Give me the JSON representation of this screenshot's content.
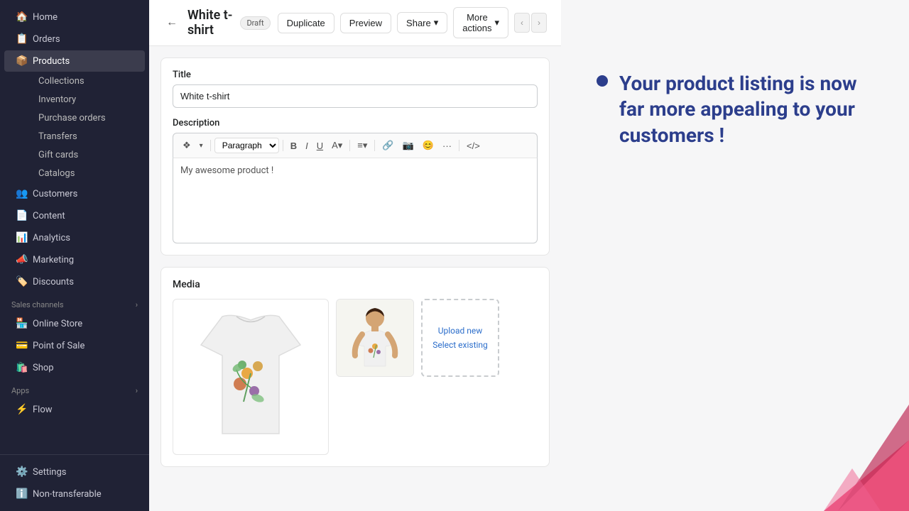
{
  "sidebar": {
    "items": [
      {
        "label": "Home",
        "icon": "🏠",
        "id": "home"
      },
      {
        "label": "Orders",
        "icon": "📋",
        "id": "orders"
      },
      {
        "label": "Products",
        "icon": "📦",
        "id": "products",
        "active": true
      },
      {
        "label": "Customers",
        "icon": "👥",
        "id": "customers"
      },
      {
        "label": "Content",
        "icon": "📄",
        "id": "content"
      },
      {
        "label": "Analytics",
        "icon": "📊",
        "id": "analytics"
      },
      {
        "label": "Marketing",
        "icon": "📣",
        "id": "marketing"
      },
      {
        "label": "Discounts",
        "icon": "🏷️",
        "id": "discounts"
      }
    ],
    "sub_items": [
      {
        "label": "Collections",
        "id": "collections"
      },
      {
        "label": "Inventory",
        "id": "inventory"
      },
      {
        "label": "Purchase orders",
        "id": "purchase-orders"
      },
      {
        "label": "Transfers",
        "id": "transfers"
      },
      {
        "label": "Gift cards",
        "id": "gift-cards"
      },
      {
        "label": "Catalogs",
        "id": "catalogs"
      }
    ],
    "sales_channels_label": "Sales channels",
    "sales_channels": [
      {
        "label": "Online Store",
        "icon": "🏪",
        "id": "online-store"
      },
      {
        "label": "Point of Sale",
        "icon": "💳",
        "id": "pos"
      },
      {
        "label": "Shop",
        "icon": "🛍️",
        "id": "shop"
      }
    ],
    "apps_label": "Apps",
    "apps": [
      {
        "label": "Flow",
        "icon": "⚡",
        "id": "flow"
      }
    ],
    "bottom_items": [
      {
        "label": "Settings",
        "icon": "⚙️",
        "id": "settings"
      },
      {
        "label": "Non-transferable",
        "icon": "ℹ️",
        "id": "non-transferable"
      }
    ]
  },
  "header": {
    "back_label": "←",
    "title": "White t-shirt",
    "badge": "Draft",
    "duplicate_label": "Duplicate",
    "preview_label": "Preview",
    "share_label": "Share",
    "more_actions_label": "More actions"
  },
  "form": {
    "title_label": "Title",
    "title_value": "White t-shirt",
    "description_label": "Description",
    "description_value": "My awesome product !",
    "description_placeholder": "Paragraph",
    "toolbar_items": [
      "❖",
      "Paragraph",
      "B",
      "I",
      "U",
      "A",
      "≡",
      "🔗",
      "📷",
      "😊",
      "···",
      "</>"
    ]
  },
  "media": {
    "section_title": "Media",
    "upload_new_label": "Upload new",
    "select_existing_label": "Select existing"
  },
  "promo": {
    "text": "Your product listing is now far more appealing to your customers !"
  }
}
